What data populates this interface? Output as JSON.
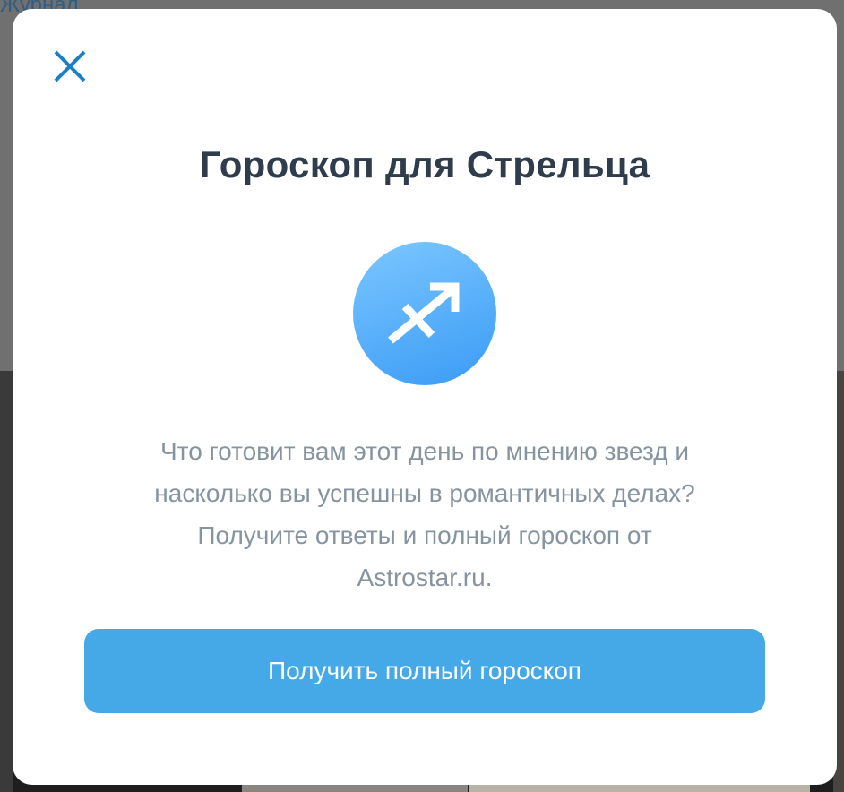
{
  "backdrop": {
    "label": "Журнал"
  },
  "modal": {
    "close_icon": "close-icon",
    "title": "Гороскоп для Стрельца",
    "sign_icon": "sagittarius-icon",
    "description_lines": [
      "Что готовит вам этот день по мнению звезд и",
      "насколько вы успешны в романтичных делах?",
      "Получите ответы и полный гороскоп от",
      "Astrostar.ru."
    ],
    "cta_label": "Получить полный гороскоп"
  },
  "colors": {
    "accent": "#45a9e8",
    "close_icon": "#1a7fc4",
    "title": "#2f3c4c",
    "description": "#8693a0",
    "sign_gradient_start": "#7cc7ff",
    "sign_gradient_end": "#3a9bf5"
  }
}
